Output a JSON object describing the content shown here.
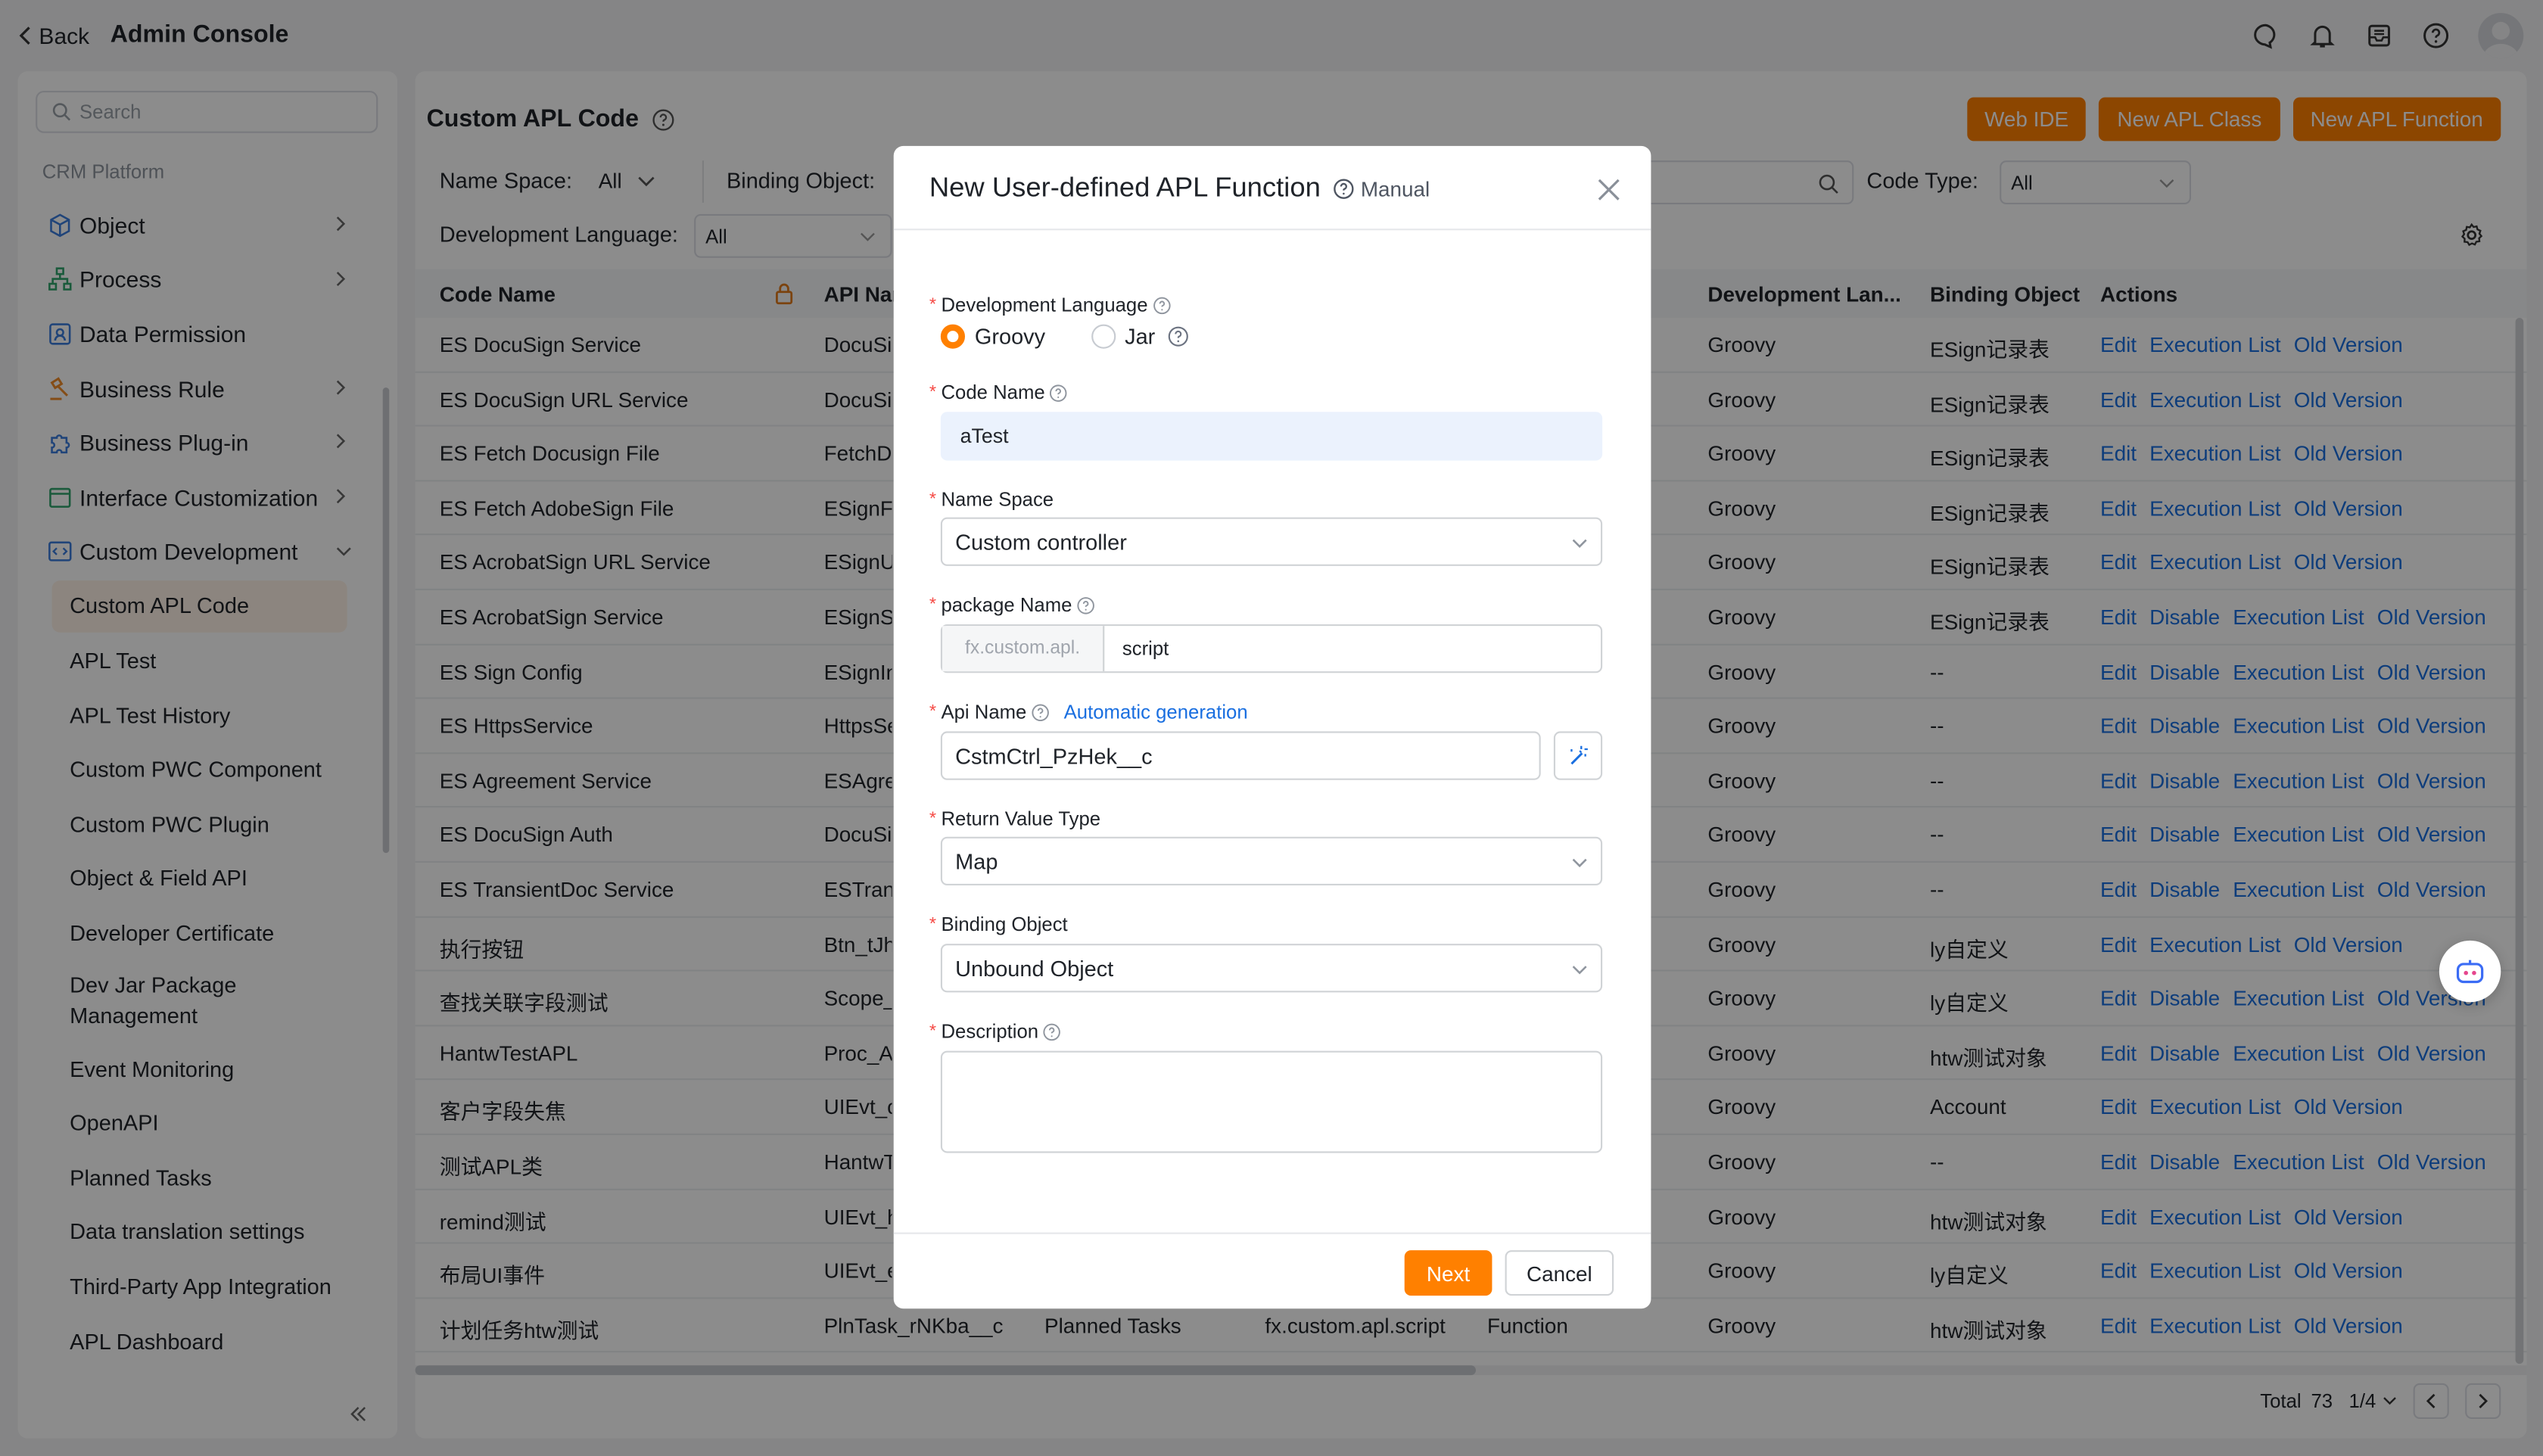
{
  "topbar": {
    "back_label": "Back",
    "title": "Admin Console"
  },
  "sidebar": {
    "search_placeholder": "Search",
    "section": "CRM Platform",
    "items": [
      {
        "label": "Object"
      },
      {
        "label": "Process"
      },
      {
        "label": "Data Permission"
      },
      {
        "label": "Business Rule"
      },
      {
        "label": "Business Plug-in"
      },
      {
        "label": "Interface Customization"
      },
      {
        "label": "Custom Development"
      }
    ],
    "sub_items": [
      {
        "label": "Custom APL Code"
      },
      {
        "label": "APL Test"
      },
      {
        "label": "APL Test History"
      },
      {
        "label": "Custom PWC Component"
      },
      {
        "label": "Custom PWC Plugin"
      },
      {
        "label": "Object & Field API"
      },
      {
        "label": "Developer Certificate"
      },
      {
        "label": "Dev Jar Package Management"
      },
      {
        "label": "Event Monitoring"
      },
      {
        "label": "OpenAPI"
      },
      {
        "label": "Planned Tasks"
      },
      {
        "label": "Data translation settings"
      },
      {
        "label": "Third-Party App Integration"
      },
      {
        "label": "APL Dashboard"
      }
    ]
  },
  "main": {
    "title": "Custom APL Code",
    "buttons": {
      "web_ide": "Web IDE",
      "new_class": "New APL Class",
      "new_function": "New APL Function"
    },
    "filters": {
      "name_space_label": "Name Space:",
      "name_space_value": "All",
      "binding_object_label": "Binding Object:",
      "code_type_label": "Code Type:",
      "code_type_value": "All",
      "dev_lang_label": "Development Language:",
      "dev_lang_value": "All"
    },
    "columns": {
      "code_name": "Code Name",
      "api_name": "API Nam",
      "dev_lang": "Development Lan...",
      "binding_object": "Binding Object",
      "actions": "Actions"
    },
    "action_labels": {
      "edit": "Edit",
      "disable": "Disable",
      "execution_list": "Execution List",
      "old_version": "Old Version"
    },
    "rows": [
      {
        "code": "ES DocuSign Service",
        "api": "DocuSig",
        "lang": "Groovy",
        "binding": "ESign记录表",
        "disable": false
      },
      {
        "code": "ES DocuSign URL Service",
        "api": "DocuSig",
        "lang": "Groovy",
        "binding": "ESign记录表",
        "disable": false
      },
      {
        "code": "ES Fetch Docusign File",
        "api": "FetchDo",
        "lang": "Groovy",
        "binding": "ESign记录表",
        "disable": false
      },
      {
        "code": "ES Fetch AdobeSign File",
        "api": "ESignFe",
        "lang": "Groovy",
        "binding": "ESign记录表",
        "disable": false
      },
      {
        "code": "ES AcrobatSign URL Service",
        "api": "ESignUl",
        "lang": "Groovy",
        "binding": "ESign记录表",
        "disable": false
      },
      {
        "code": "ES AcrobatSign Service",
        "api": "ESignSe",
        "lang": "Groovy",
        "binding": "ESign记录表",
        "disable": true
      },
      {
        "code": "ES Sign Config",
        "api": "ESignIn",
        "lang": "Groovy",
        "binding": "--",
        "disable": true
      },
      {
        "code": "ES HttpsService",
        "api": "HttpsSe",
        "lang": "Groovy",
        "binding": "--",
        "disable": true
      },
      {
        "code": "ES Agreement Service",
        "api": "ESAgre",
        "lang": "Groovy",
        "binding": "--",
        "disable": true
      },
      {
        "code": "ES DocuSign Auth",
        "api": "DocuSig",
        "lang": "Groovy",
        "binding": "--",
        "disable": true
      },
      {
        "code": "ES TransientDoc Service",
        "api": "ESTrans",
        "lang": "Groovy",
        "binding": "--",
        "disable": true
      },
      {
        "code": "执行按钮",
        "api": "Btn_tJh",
        "lang": "Groovy",
        "binding": "ly自定义",
        "disable": false
      },
      {
        "code": "查找关联字段测试",
        "api": "Scope_",
        "lang": "Groovy",
        "binding": "ly自定义",
        "disable": true
      },
      {
        "code": "HantwTestAPL",
        "api": "Proc_Ar",
        "lang": "Groovy",
        "binding": "htw测试对象",
        "disable": true
      },
      {
        "code": "客户字段失焦",
        "api": "UIEvt_c",
        "lang": "Groovy",
        "binding": "Account",
        "disable": false
      },
      {
        "code": "测试APL类",
        "api": "HantwT",
        "lang": "Groovy",
        "binding": "--",
        "disable": true
      },
      {
        "code": "remind测试",
        "api": "UIEvt_h",
        "lang": "Groovy",
        "binding": "htw测试对象",
        "disable": false
      },
      {
        "code": "布局UI事件",
        "api": "UIEvt_e",
        "lang": "Groovy",
        "binding": "ly自定义",
        "disable": false
      },
      {
        "code": "计划任务htw测试",
        "api": "PlnTask_rNKba__c",
        "ns": "Planned Tasks",
        "pkg": "fx.custom.apl.script",
        "type": "Function",
        "lang": "Groovy",
        "binding": "htw测试对象",
        "disable": false
      }
    ],
    "pager": {
      "total_label": "Total",
      "total": "73",
      "page": "1/4"
    }
  },
  "modal": {
    "title": "New User-defined APL Function",
    "manual": "Manual",
    "dev_lang_label": "Development Language",
    "groovy": "Groovy",
    "jar": "Jar",
    "code_name_label": "Code Name",
    "code_name_value": "aTest",
    "name_space_label": "Name Space",
    "name_space_value": "Custom controller",
    "package_label": "package Name",
    "package_prefix": "fx.custom.apl.",
    "package_value": "script",
    "api_name_label": "Api Name",
    "auto_gen": "Automatic generation",
    "api_name_value": "CstmCtrl_PzHek__c",
    "return_type_label": "Return Value Type",
    "return_type_value": "Map",
    "binding_label": "Binding Object",
    "binding_value": "Unbound Object",
    "description_label": "Description",
    "description_value": "",
    "next": "Next",
    "cancel": "Cancel"
  }
}
